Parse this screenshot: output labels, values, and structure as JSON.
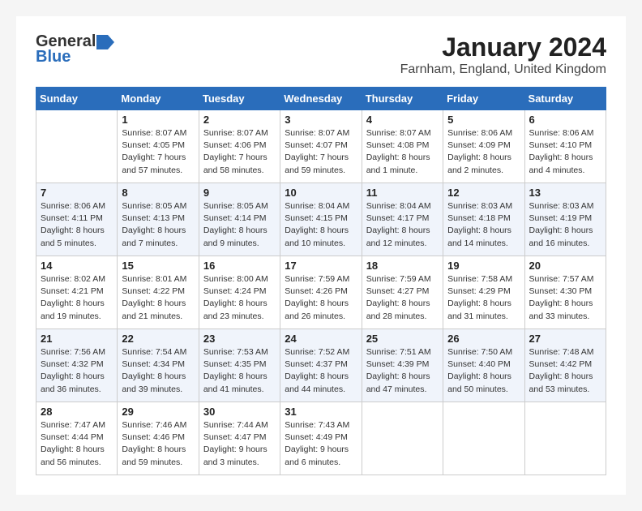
{
  "logo": {
    "general": "General",
    "blue": "Blue"
  },
  "title": "January 2024",
  "subtitle": "Farnham, England, United Kingdom",
  "days_of_week": [
    "Sunday",
    "Monday",
    "Tuesday",
    "Wednesday",
    "Thursday",
    "Friday",
    "Saturday"
  ],
  "weeks": [
    [
      {
        "day": "",
        "info": ""
      },
      {
        "day": "1",
        "info": "Sunrise: 8:07 AM\nSunset: 4:05 PM\nDaylight: 7 hours\nand 57 minutes."
      },
      {
        "day": "2",
        "info": "Sunrise: 8:07 AM\nSunset: 4:06 PM\nDaylight: 7 hours\nand 58 minutes."
      },
      {
        "day": "3",
        "info": "Sunrise: 8:07 AM\nSunset: 4:07 PM\nDaylight: 7 hours\nand 59 minutes."
      },
      {
        "day": "4",
        "info": "Sunrise: 8:07 AM\nSunset: 4:08 PM\nDaylight: 8 hours\nand 1 minute."
      },
      {
        "day": "5",
        "info": "Sunrise: 8:06 AM\nSunset: 4:09 PM\nDaylight: 8 hours\nand 2 minutes."
      },
      {
        "day": "6",
        "info": "Sunrise: 8:06 AM\nSunset: 4:10 PM\nDaylight: 8 hours\nand 4 minutes."
      }
    ],
    [
      {
        "day": "7",
        "info": "Sunrise: 8:06 AM\nSunset: 4:11 PM\nDaylight: 8 hours\nand 5 minutes."
      },
      {
        "day": "8",
        "info": "Sunrise: 8:05 AM\nSunset: 4:13 PM\nDaylight: 8 hours\nand 7 minutes."
      },
      {
        "day": "9",
        "info": "Sunrise: 8:05 AM\nSunset: 4:14 PM\nDaylight: 8 hours\nand 9 minutes."
      },
      {
        "day": "10",
        "info": "Sunrise: 8:04 AM\nSunset: 4:15 PM\nDaylight: 8 hours\nand 10 minutes."
      },
      {
        "day": "11",
        "info": "Sunrise: 8:04 AM\nSunset: 4:17 PM\nDaylight: 8 hours\nand 12 minutes."
      },
      {
        "day": "12",
        "info": "Sunrise: 8:03 AM\nSunset: 4:18 PM\nDaylight: 8 hours\nand 14 minutes."
      },
      {
        "day": "13",
        "info": "Sunrise: 8:03 AM\nSunset: 4:19 PM\nDaylight: 8 hours\nand 16 minutes."
      }
    ],
    [
      {
        "day": "14",
        "info": "Sunrise: 8:02 AM\nSunset: 4:21 PM\nDaylight: 8 hours\nand 19 minutes."
      },
      {
        "day": "15",
        "info": "Sunrise: 8:01 AM\nSunset: 4:22 PM\nDaylight: 8 hours\nand 21 minutes."
      },
      {
        "day": "16",
        "info": "Sunrise: 8:00 AM\nSunset: 4:24 PM\nDaylight: 8 hours\nand 23 minutes."
      },
      {
        "day": "17",
        "info": "Sunrise: 7:59 AM\nSunset: 4:26 PM\nDaylight: 8 hours\nand 26 minutes."
      },
      {
        "day": "18",
        "info": "Sunrise: 7:59 AM\nSunset: 4:27 PM\nDaylight: 8 hours\nand 28 minutes."
      },
      {
        "day": "19",
        "info": "Sunrise: 7:58 AM\nSunset: 4:29 PM\nDaylight: 8 hours\nand 31 minutes."
      },
      {
        "day": "20",
        "info": "Sunrise: 7:57 AM\nSunset: 4:30 PM\nDaylight: 8 hours\nand 33 minutes."
      }
    ],
    [
      {
        "day": "21",
        "info": "Sunrise: 7:56 AM\nSunset: 4:32 PM\nDaylight: 8 hours\nand 36 minutes."
      },
      {
        "day": "22",
        "info": "Sunrise: 7:54 AM\nSunset: 4:34 PM\nDaylight: 8 hours\nand 39 minutes."
      },
      {
        "day": "23",
        "info": "Sunrise: 7:53 AM\nSunset: 4:35 PM\nDaylight: 8 hours\nand 41 minutes."
      },
      {
        "day": "24",
        "info": "Sunrise: 7:52 AM\nSunset: 4:37 PM\nDaylight: 8 hours\nand 44 minutes."
      },
      {
        "day": "25",
        "info": "Sunrise: 7:51 AM\nSunset: 4:39 PM\nDaylight: 8 hours\nand 47 minutes."
      },
      {
        "day": "26",
        "info": "Sunrise: 7:50 AM\nSunset: 4:40 PM\nDaylight: 8 hours\nand 50 minutes."
      },
      {
        "day": "27",
        "info": "Sunrise: 7:48 AM\nSunset: 4:42 PM\nDaylight: 8 hours\nand 53 minutes."
      }
    ],
    [
      {
        "day": "28",
        "info": "Sunrise: 7:47 AM\nSunset: 4:44 PM\nDaylight: 8 hours\nand 56 minutes."
      },
      {
        "day": "29",
        "info": "Sunrise: 7:46 AM\nSunset: 4:46 PM\nDaylight: 8 hours\nand 59 minutes."
      },
      {
        "day": "30",
        "info": "Sunrise: 7:44 AM\nSunset: 4:47 PM\nDaylight: 9 hours\nand 3 minutes."
      },
      {
        "day": "31",
        "info": "Sunrise: 7:43 AM\nSunset: 4:49 PM\nDaylight: 9 hours\nand 6 minutes."
      },
      {
        "day": "",
        "info": ""
      },
      {
        "day": "",
        "info": ""
      },
      {
        "day": "",
        "info": ""
      }
    ]
  ]
}
